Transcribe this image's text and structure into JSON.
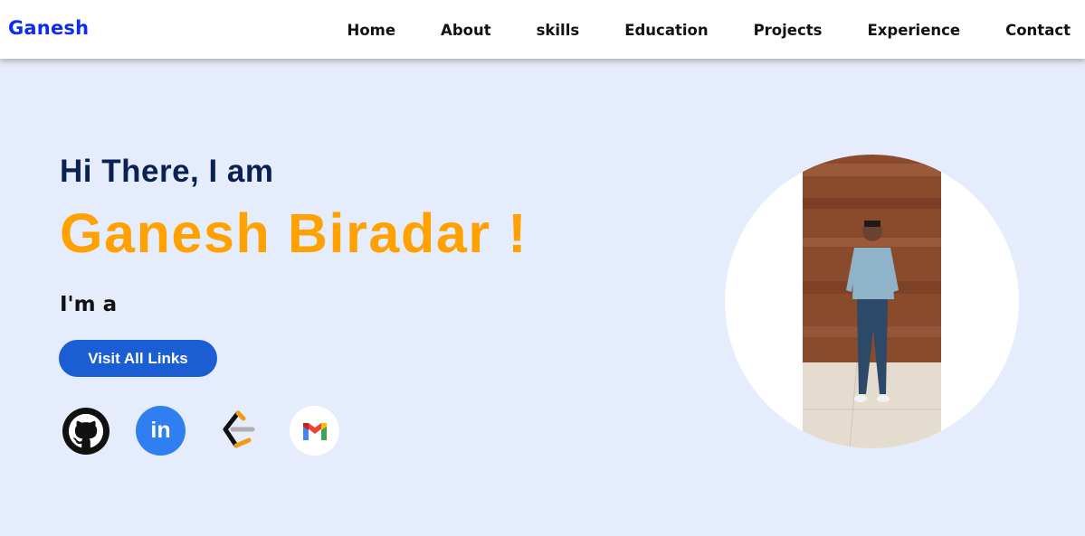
{
  "nav": {
    "brand": "Ganesh",
    "links": [
      "Home",
      "About",
      "skills",
      "Education",
      "Projects",
      "Experience",
      "Contact"
    ]
  },
  "hero": {
    "greeting": "Hi There, I am",
    "name": "Ganesh Biradar !",
    "role_prefix": "I'm a",
    "cta_label": "Visit All Links"
  },
  "socials": [
    {
      "icon": "github-icon"
    },
    {
      "icon": "linkedin-icon",
      "text": "in"
    },
    {
      "icon": "leetcode-icon"
    },
    {
      "icon": "gmail-icon"
    }
  ],
  "colors": {
    "background": "#e5ecfb",
    "brand": "#0e2bf0",
    "greeting": "#0b2152",
    "name": "#ffa100",
    "cta": "#1b5ed3",
    "linkedin": "#2f7ff0"
  }
}
